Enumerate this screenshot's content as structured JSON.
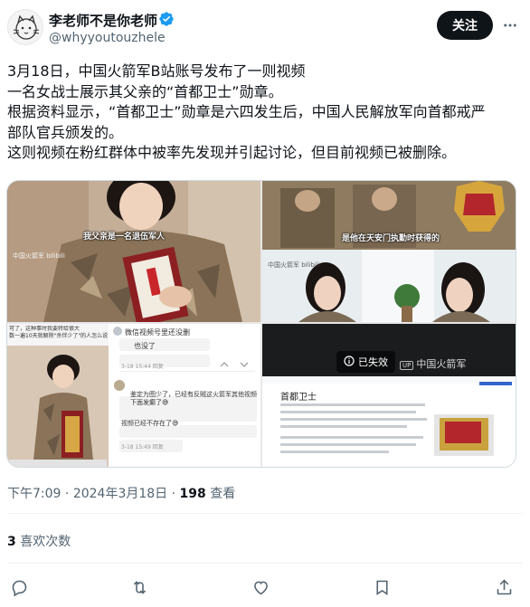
{
  "author": {
    "name": "李老师不是你老师",
    "handle": "@whyyoutouzhele",
    "follow_label": "关注"
  },
  "tweet": {
    "lines": [
      "3月18日，中国火箭军B站账号发布了一则视频",
      "一名女战士展示其父亲的“首都卫士”勋章。",
      "根据资料显示，“首都卫士”勋章是六四发生后，中国人民解放军向首都戒严",
      "部队官兵颁发的。",
      "这则视频在粉红群体中被率先发现并引起讨论，但目前视频已被删除。"
    ]
  },
  "media": {
    "cell1_caption": "我父亲是一名退伍军人",
    "cell1_watermark": "中国火箭军 bilibili",
    "cell2_caption": "是他在天安门执勤时获得的",
    "cell2_watermark": "中国火箭军 bilibili",
    "cell3_left_caption": "可了，这种事时我要转给很大\n数一遍10天就解除\"杀伴少了\"的人怎么说",
    "cell3_chat": [
      "微信视频号里还没删",
      "也没了",
      "鉴定为图少了，已经有反贼这火箭军其他视频下面发癫了😅",
      "视频已经不存在了😅"
    ],
    "cell3_times": [
      "3-18 15:44 回复",
      "3-18 15:49 回复"
    ],
    "cell4_unavailable": "已失效",
    "cell4_channel": "中国火箭军",
    "cell4_wiki_title": "首都卫士"
  },
  "meta": {
    "time": "下午7:09",
    "sep": "·",
    "date": "2024年3月18日",
    "views_count": "198",
    "views_label": "查看"
  },
  "likes": {
    "count": "3",
    "label": "喜欢次数"
  },
  "icons": {
    "reply": "reply-icon",
    "retweet": "retweet-icon",
    "like": "heart-icon",
    "bookmark": "bookmark-icon",
    "share": "share-icon"
  },
  "colors": {
    "text": "#0f1419",
    "secondary": "#536471",
    "verified": "#1d9bf0",
    "follow_bg": "#0f1419"
  }
}
